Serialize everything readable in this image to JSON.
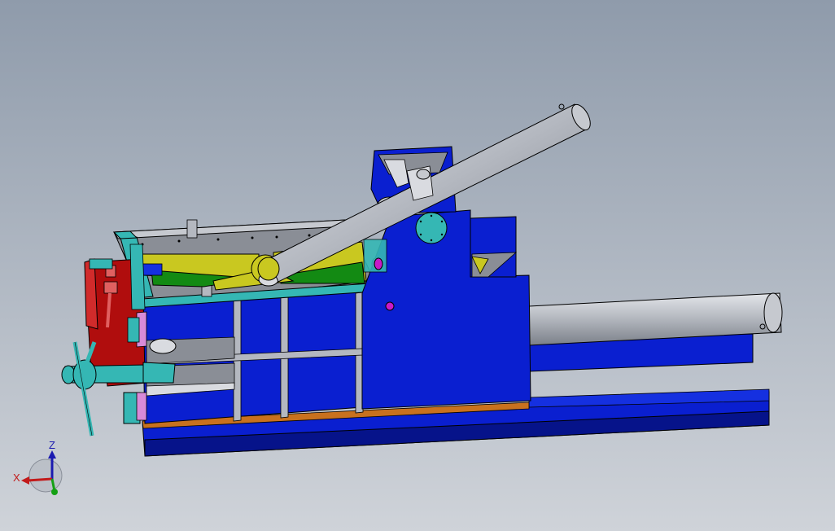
{
  "viewport": {
    "background_top": "#8f9bab",
    "background_bottom": "#cdd1d7",
    "model": "baler-press-assembly"
  },
  "triad": {
    "z_label": "Z",
    "x_label": "X",
    "z_color": "#1a1ab0",
    "x_color": "#c21a1a",
    "y_color": "#14a014"
  },
  "colors": {
    "frame_blue": "#0a1fd0",
    "frame_blue_dark": "#06138a",
    "cylinder_grey": "#b4b8c0",
    "yellow": "#c9c820",
    "green": "#138a13",
    "teal": "#35b7b4",
    "red": "#b00d0d",
    "magenta": "#c81ac8",
    "orange": "#c8711e",
    "plate_grey": "#8a8e96"
  }
}
